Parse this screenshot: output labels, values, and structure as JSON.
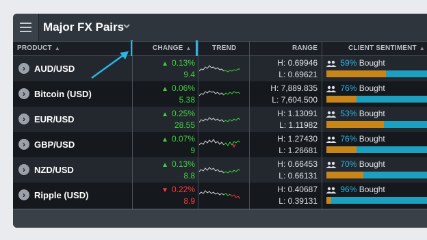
{
  "title": "Major FX Pairs",
  "columns": {
    "product": "PRODUCT",
    "change": "CHANGE",
    "trend": "TREND",
    "range": "RANGE",
    "sentiment": "CLIENT SENTIMENT"
  },
  "sentiment_word": "Bought",
  "colors": {
    "up": "#3fd23f",
    "down": "#ff3b3b",
    "accent": "#2bb6e6",
    "bought_bar": "#c8861a",
    "sold_bar": "#1d9fc0"
  },
  "rows": [
    {
      "product": "AUD/USD",
      "direction": "up",
      "change_pct": "0.13%",
      "change_pts": "9.4",
      "high": "H: 0.69946",
      "low": "L: 0.69621",
      "bought_label": "59%",
      "bought_fraction": 0.59
    },
    {
      "product": "Bitcoin (USD)",
      "direction": "up",
      "change_pct": "0.06%",
      "change_pts": "5.38",
      "high": "H: 7,889.835",
      "low": "L: 7,604.500",
      "bought_label": "76%",
      "bought_fraction": 0.3
    },
    {
      "product": "EUR/USD",
      "direction": "up",
      "change_pct": "0.25%",
      "change_pts": "28.55",
      "high": "H: 1.13091",
      "low": "L: 1.11982",
      "bought_label": "53%",
      "bought_fraction": 0.57
    },
    {
      "product": "GBP/USD",
      "direction": "up",
      "change_pct": "0.07%",
      "change_pts": "9",
      "high": "H: 1.27430",
      "low": "L: 1.26681",
      "bought_label": "76%",
      "bought_fraction": 0.3
    },
    {
      "product": "NZD/USD",
      "direction": "up",
      "change_pct": "0.13%",
      "change_pts": "8.8",
      "high": "H: 0.66453",
      "low": "L: 0.66131",
      "bought_label": "70%",
      "bought_fraction": 0.37
    },
    {
      "product": "Ripple (USD)",
      "direction": "down",
      "change_pct": "0.22%",
      "change_pts": "8.9",
      "high": "H: 0.40687",
      "low": "L: 0.39131",
      "bought_label": "96%",
      "bought_fraction": 0.05
    }
  ]
}
